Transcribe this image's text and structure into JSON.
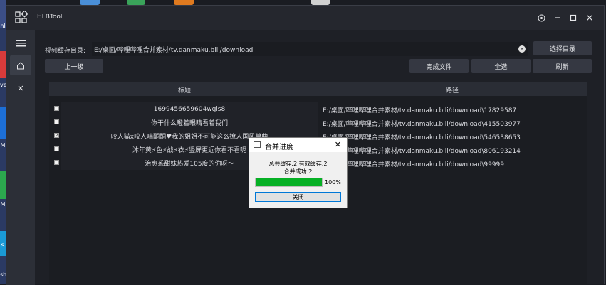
{
  "window": {
    "title": "HLBTool"
  },
  "titlebar_icons": [
    "settings-icon",
    "minimize-icon",
    "maximize-icon",
    "close-icon"
  ],
  "sidebar": {
    "items": [
      {
        "name": "menu-icon"
      },
      {
        "name": "home-icon"
      },
      {
        "name": "close-icon"
      }
    ]
  },
  "toolbar": {
    "dir_label": "视频缓存目录:",
    "dir_value": "E:/桌面/哔哩哔哩合并素材/tv.danmaku.bili/download",
    "choose_dir": "选择目录",
    "up_level": "上一级",
    "finished_files": "完成文件",
    "select_all": "全选",
    "refresh": "刷新"
  },
  "table": {
    "headers": [
      "标题",
      "路径"
    ],
    "rows": [
      {
        "checked": false,
        "title": "1699456659604wgis8",
        "path": "E:/桌面/哔哩哔哩合并素材/tv.danmaku.bili/download\\17829587"
      },
      {
        "checked": false,
        "title": "你干什么瞪着眼睛看着我们",
        "path": "E:/桌面/哔哩哔哩合并素材/tv.danmaku.bili/download\\415503977"
      },
      {
        "checked": true,
        "title": "咬人猫x咬人喵酮酮♥我的姐姐不可能这么撩人国风单曲",
        "path": "E:/桌面/哔哩哔哩合并素材/tv.danmaku.bili/download\\546538653"
      },
      {
        "checked": false,
        "title": "沐年黄⚡色⚡战⚡衣⚡竖屏更近你看不看呢",
        "path": "E:/桌面/哔哩哔哩合并素材/tv.danmaku.bili/download\\806193214"
      },
      {
        "checked": false,
        "title": "治愈系甜妹热爱105度的你呀～",
        "path": "E:/桌面/哔哩哔哩合并素材/tv.danmaku.bili/download\\99999"
      }
    ]
  },
  "dialog": {
    "title": "合并进度",
    "line1": "总共缓存:2,有效缓存:2",
    "line2": "合并成功:2",
    "progress": 100,
    "progress_text": "100%",
    "close_label": "关闭"
  },
  "desktop": {
    "side_labels": [
      "nl",
      "ve",
      "M",
      "M",
      "s",
      "sh"
    ]
  }
}
